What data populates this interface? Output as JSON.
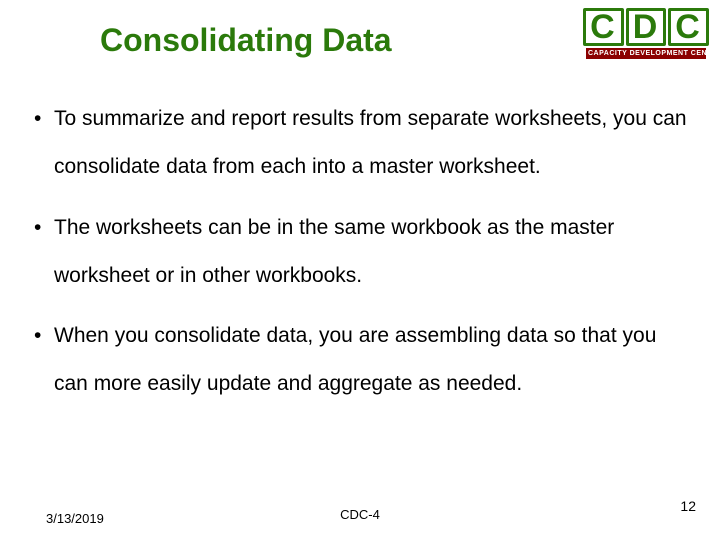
{
  "logo": {
    "c1": "C",
    "c2": "D",
    "c3": "C",
    "sub": "CAPACITY DEVELOPMENT CENTER"
  },
  "title": "Consolidating Data",
  "bullets": [
    "To summarize and report results from separate worksheets, you can consolidate data from each into a master worksheet.",
    "The worksheets can be in the same workbook as the master worksheet or in other workbooks.",
    "When you consolidate data, you are assembling data so that you can more easily update and aggregate as needed."
  ],
  "footer": {
    "date": "3/13/2019",
    "center": "CDC-4",
    "page": "12"
  }
}
